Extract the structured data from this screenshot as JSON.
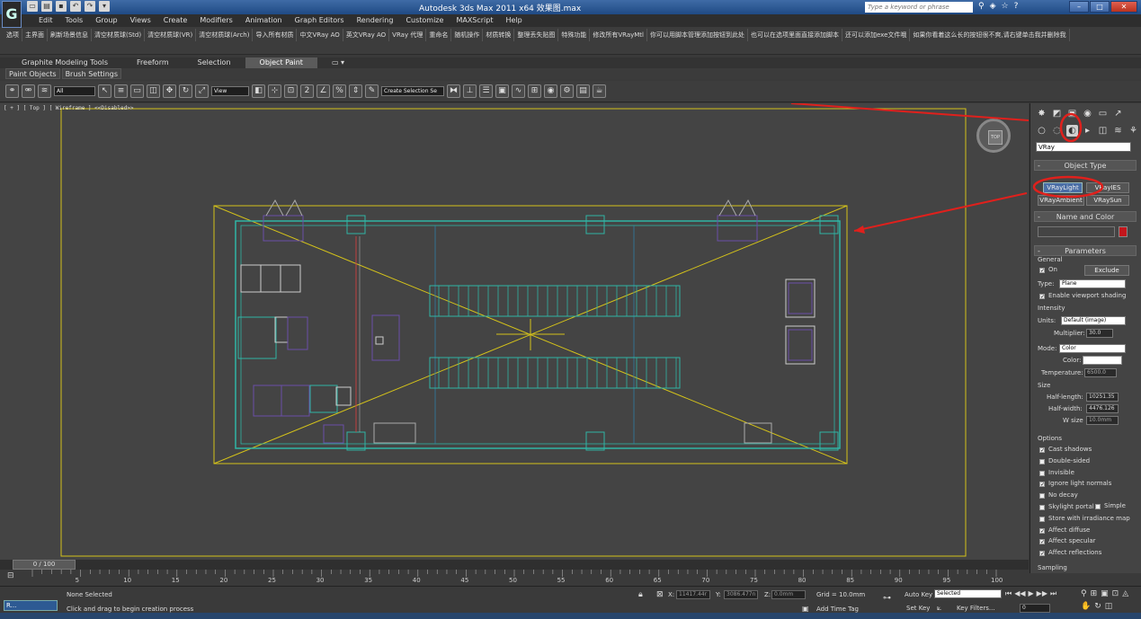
{
  "app": {
    "logo": "G",
    "title": "Autodesk 3ds Max  2011 x64    效果图.max",
    "search_placeholder": "Type a keyword or phrase"
  },
  "menu": [
    "Edit",
    "Tools",
    "Group",
    "Views",
    "Create",
    "Modifiers",
    "Animation",
    "Graph Editors",
    "Rendering",
    "Customize",
    "MAXScript",
    "Help"
  ],
  "script_buttons": [
    "选项",
    "主界面",
    "刷新场景信息",
    "清空材质球(Std)",
    "清空材质球(VR)",
    "清空材质球(Arch)",
    "导入所有材质",
    "中文VRay AO",
    "英文VRay AO",
    "VRay 代理",
    "重命名",
    "随机操作",
    "材质转换",
    "整理丢失贴图",
    "特殊功能",
    "修改所有VRayMtl",
    "你可以用脚本管理添加按钮到此处",
    "也可以在选项里面直接添加脚本",
    "还可以添加exe文件哦",
    "如果你看着这么长的按钮很不爽,请右键单击我并删除我"
  ],
  "ribbon": {
    "tabs": [
      "Graphite Modeling Tools",
      "Freeform",
      "Selection",
      "Object Paint"
    ],
    "active_tab": "Object Paint",
    "subtabs": [
      "Paint Objects",
      "Brush Settings"
    ]
  },
  "toolbar": {
    "filter": "All",
    "ref_coord": "View",
    "selection_set": "Create Selection Se"
  },
  "viewport": {
    "label": "[ + ] [ Top ] [ Wireframe ] <<Disabled>>",
    "viewcube_face": "TOP",
    "wire_color": "#d4c21a",
    "object_color": "#2fb5a5",
    "furniture_color": "#6a4ea8"
  },
  "command_panel": {
    "category": "VRay",
    "object_type_title": "Object Type",
    "object_types": [
      "VRayLight",
      "VRayIES",
      "VRayAmbient",
      "VRaySun"
    ],
    "active_object_type": "VRayLight",
    "name_color_title": "Name and Color",
    "name_value": "",
    "object_swatch": "#c4161c",
    "parameters_title": "Parameters",
    "general_label": "General",
    "on_label": "On",
    "exclude_label": "Exclude",
    "type_label": "Type:",
    "type_value": "Plane",
    "enable_viewport_shading": "Enable viewport shading",
    "intensity_label": "Intensity",
    "units_label": "Units:",
    "units_value": "Default (image)",
    "multiplier_label": "Multiplier:",
    "multiplier_value": "30.0",
    "mode_label": "Mode:",
    "mode_value": "Color",
    "color_label": "Color:",
    "light_color": "#ffffff",
    "temperature_label": "Temperature:",
    "temperature_value": "6500.0",
    "size_label": "Size",
    "half_length_label": "Half-length:",
    "half_length_value": "10251.35",
    "half_width_label": "Half-width:",
    "half_width_value": "4476.126",
    "w_size_label": "W size",
    "w_size_value": "10.0mm",
    "options_label": "Options",
    "options": [
      {
        "label": "Cast shadows",
        "checked": true
      },
      {
        "label": "Double-sided",
        "checked": false
      },
      {
        "label": "Invisible",
        "checked": false
      },
      {
        "label": "Ignore light normals",
        "checked": true
      },
      {
        "label": "No decay",
        "checked": false
      },
      {
        "label": "Skylight portal",
        "checked": false
      },
      {
        "label": "Store with irradiance map",
        "checked": false
      },
      {
        "label": "Affect diffuse",
        "checked": true
      },
      {
        "label": "Affect specular",
        "checked": true
      },
      {
        "label": "Affect reflections",
        "checked": true
      }
    ],
    "simple_label": "Simple",
    "sampling_label": "Sampling"
  },
  "timeline": {
    "frame_display": "0 / 100",
    "ticks": [
      "5",
      "10",
      "15",
      "20",
      "25",
      "30",
      "35",
      "40",
      "45",
      "50",
      "55",
      "60",
      "65",
      "70",
      "75",
      "80",
      "85",
      "90",
      "95",
      "100"
    ]
  },
  "status": {
    "selection": "None Selected",
    "prompt": "Click and drag to begin creation process",
    "listener": "R...",
    "x_label": "X:",
    "x_value": "11417.44r",
    "y_label": "Y:",
    "y_value": "3086.477n",
    "z_label": "Z:",
    "z_value": "0.0mm",
    "grid": "Grid = 10.0mm",
    "auto_key": "Auto Key",
    "auto_key_value": "Selected",
    "set_key": "Set Key",
    "key_filters": "Key Filters...",
    "add_time_tag": "Add Time Tag",
    "frame_value": "0"
  }
}
